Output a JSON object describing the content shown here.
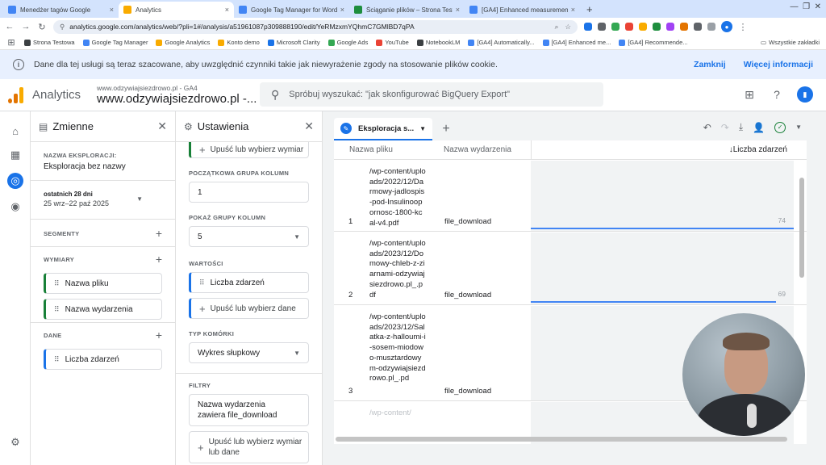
{
  "browser": {
    "tabs": [
      {
        "title": "Menedżer tagów Google",
        "color": "#4285f4",
        "active": false
      },
      {
        "title": "Analytics",
        "color": "#f9ab00",
        "active": true
      },
      {
        "title": "Google Tag Manager for WordP",
        "color": "#4285f4",
        "active": false
      },
      {
        "title": "Ściąganie plików – Strona Testo",
        "color": "#1e8e3e",
        "active": false
      },
      {
        "title": "[GA4] Enhanced measurement",
        "color": "#4285f4",
        "active": false
      }
    ],
    "close_glyph": "×",
    "new_tab_glyph": "+",
    "url": "analytics.google.com/analytics/web/?pli=1#/analysis/a51961087p309888190/edit/YeRMzxmYQhmC7GMlBD7qPA",
    "bookmarks": [
      {
        "label": "Strona Testowa",
        "color": "#3c4043"
      },
      {
        "label": "Google Tag Manager",
        "color": "#4285f4"
      },
      {
        "label": "Google Analytics",
        "color": "#f9ab00"
      },
      {
        "label": "Konto demo",
        "color": "#f9ab00"
      },
      {
        "label": "Microsoft Clarity",
        "color": "#1a73e8"
      },
      {
        "label": "Google Ads",
        "color": "#34a853"
      },
      {
        "label": "YouTube",
        "color": "#ea4335"
      },
      {
        "label": "NotebookLM",
        "color": "#3c4043"
      },
      {
        "label": "[GA4] Automatically...",
        "color": "#4285f4"
      },
      {
        "label": "[GA4] Enhanced me...",
        "color": "#4285f4"
      },
      {
        "label": "[GA4] Recommende...",
        "color": "#4285f4"
      }
    ],
    "bookmarks_all": "Wszystkie zakładki"
  },
  "banner": {
    "text": "Dane dla tej usługi są teraz szacowane, aby uwzględnić czynniki takie jak niewyrażenie zgody na stosowanie plików cookie.",
    "close": "Zamknij",
    "more": "Więcej informacji"
  },
  "header": {
    "brand": "Analytics",
    "property_small": "www.odzywiajsiezdrowo.pl - GA4",
    "property_large": "www.odzywiajsiezdrowo.pl -...",
    "search_placeholder": "Spróbuj wyszukać: \"jak skonfigurować BigQuery Export\""
  },
  "variables": {
    "title": "Zmienne",
    "exploration_label": "NAZWA EKSPLORACJI:",
    "exploration_name": "Eksploracja bez nazwy",
    "date_label": "ostatnich 28 dni",
    "date_range": "25 wrz–22 paź 2025",
    "segments": "SEGMENTY",
    "dimensions": "WYMIARY",
    "dimension_items": [
      "Nazwa pliku",
      "Nazwa wydarzenia"
    ],
    "metrics": "DANE",
    "metric_items": [
      "Liczba zdarzeń"
    ]
  },
  "settings": {
    "title": "Ustawienia",
    "drop_dimension_top": "Upuść lub wybierz wymiar",
    "start_group_label": "POCZĄTKOWA GRUPA KOLUMN",
    "start_group_value": "1",
    "show_groups_label": "POKAŻ GRUPY KOLUMN",
    "show_groups_value": "5",
    "values_label": "WARTOŚCI",
    "value_item": "Liczba zdarzeń",
    "drop_data": "Upuść lub wybierz dane",
    "cell_type_label": "TYP KOMÓRKI",
    "cell_type_value": "Wykres słupkowy",
    "filters_label": "FILTRY",
    "filter_text": "Nazwa wydarzenia zawiera file_download",
    "drop_dimension_bottom": "Upuść lub wybierz wymiar lub dane"
  },
  "canvas": {
    "tab_label": "Eksploracja s...",
    "col_file": "Nazwa pliku",
    "col_event": "Nazwa wydarzenia",
    "col_metric": "↓Liczba zdarzeń",
    "bar_max": 74,
    "rows": [
      {
        "num": "1",
        "file": "/wp-content/uploads/2022/12/Darmowy-jadlospis-pod-Insulinoopornosc-1800-kcal-v4.pdf",
        "event": "file_download",
        "value": 74
      },
      {
        "num": "2",
        "file": "/wp-content/uploads/2023/12/Domowy-chleb-z-ziarnami-odzywiajsiezdrowo.pl_.pdf",
        "event": "file_download",
        "value": 69
      },
      {
        "num": "3",
        "file": "/wp-content/uploads/2023/12/Salatka-z-halloumi-i-sosem-miodowo-musztardowym-odzywiajsiezdrowo.pl_.pd",
        "event": "file_download",
        "value": 0
      },
      {
        "num": "",
        "file": "/wp-content/",
        "event": "",
        "value": 0
      }
    ]
  },
  "colors": {
    "accent": "#1a73e8",
    "dimension": "#188038",
    "bar": "#4285f4"
  }
}
